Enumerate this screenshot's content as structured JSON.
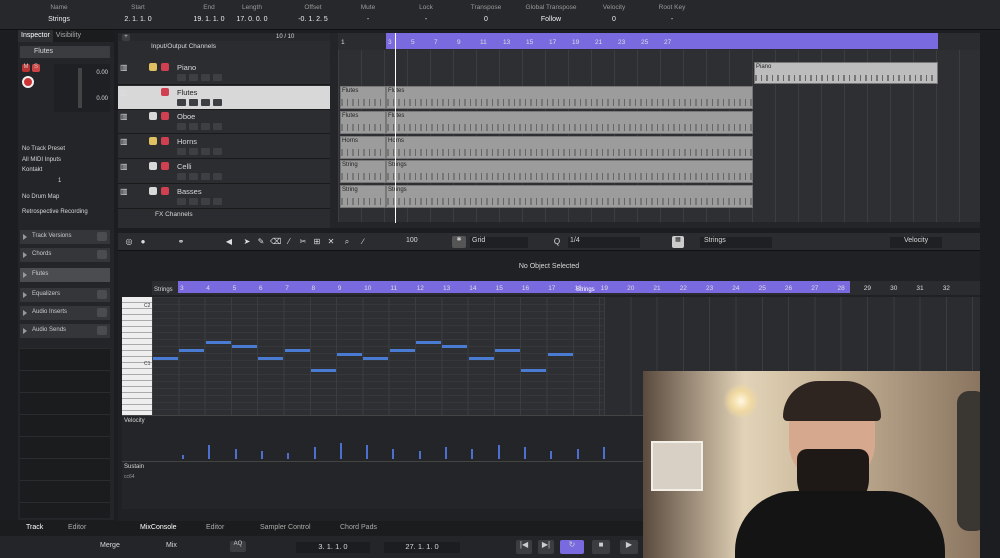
{
  "infobar": [
    {
      "label": "Name",
      "value": "Strings"
    },
    {
      "label": "Start",
      "value": "2. 1. 1.   0"
    },
    {
      "label": "End",
      "value": "19. 1. 1.   0"
    },
    {
      "label": "Length",
      "value": "17. 0. 0.   0"
    },
    {
      "label": "Offset",
      "value": "-0. 1. 2.   5"
    },
    {
      "label": "Mute",
      "value": "-"
    },
    {
      "label": "Lock",
      "value": "-"
    },
    {
      "label": "Transpose",
      "value": "0"
    },
    {
      "label": "Global Transpose",
      "value": "Follow"
    },
    {
      "label": "Velocity",
      "value": "0"
    },
    {
      "label": "Root Key",
      "value": "-"
    }
  ],
  "inspector": {
    "tabs": [
      "Inspector",
      "Visibility"
    ],
    "track_name": "Flutes",
    "vol": "0.00",
    "pan": "0.00",
    "preset": "No Track Preset",
    "midi_in": "All MIDI Inputs",
    "output": "Kontakt",
    "channel": "1",
    "drum": "No Drum Map",
    "record": "Retrospective Recording",
    "sections": [
      "Track Versions",
      "Chords",
      "Flutes",
      "Equalizers",
      "Audio Inserts",
      "Audio Sends"
    ]
  },
  "tracklist": {
    "count": "10 / 10",
    "folder": "Input/Output Channels",
    "tracks": [
      "Piano",
      "Flutes",
      "Oboe",
      "Horns",
      "Celli",
      "Basses"
    ],
    "fx": "FX Channels"
  },
  "ruler": {
    "bars": [
      "1",
      "3",
      "5",
      "7",
      "9",
      "11",
      "13",
      "15",
      "17",
      "19",
      "21",
      "23",
      "25",
      "27"
    ]
  },
  "parts": {
    "piano": "Piano",
    "flutes": [
      "Flutes",
      "Flutes"
    ],
    "oboe": [
      "Flutes",
      "Flutes"
    ],
    "horns": [
      "Horns",
      "Horns"
    ],
    "celli": [
      "String",
      "Strings"
    ],
    "basses": [
      "String",
      "Strings"
    ]
  },
  "editor_toolbar": {
    "quant": "100",
    "grid": "Grid",
    "length": "1/4",
    "track": "Strings",
    "lane": "Velocity"
  },
  "editor": {
    "status": "No Object Selected",
    "part_label": "Strings",
    "part_label2": "Strings",
    "bars": [
      "3",
      "4",
      "5",
      "6",
      "7",
      "8",
      "9",
      "10",
      "11",
      "12",
      "13",
      "14",
      "15",
      "16",
      "17",
      "18",
      "19",
      "20",
      "21",
      "22",
      "23",
      "24",
      "25",
      "26",
      "27",
      "28",
      "29",
      "30",
      "31",
      "32"
    ],
    "key_c2": "C2",
    "key_c1": "C1",
    "lanes": [
      "Velocity",
      "Sustain",
      "cc64"
    ]
  },
  "bottom_tabs": [
    "Track",
    "Editor",
    "MixConsole",
    "Editor",
    "Sampler Control",
    "Chord Pads"
  ],
  "transport": {
    "merge": "Merge",
    "mix": "Mix",
    "ax": "AQ",
    "left": "3. 1. 1.   0",
    "right": "27. 1. 1.   0"
  }
}
